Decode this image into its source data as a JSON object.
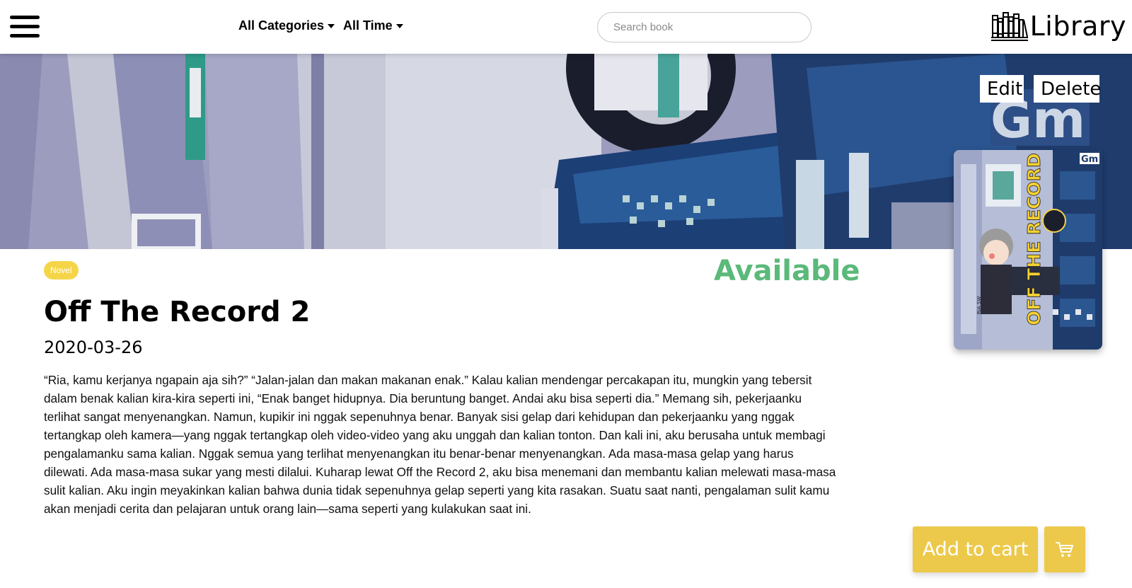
{
  "navbar": {
    "categories_label": "All Categories",
    "time_label": "All Time",
    "search_placeholder": "Search book",
    "brand": "Library"
  },
  "book": {
    "category": "Novel",
    "status": "Available",
    "title": "Off The Record 2",
    "date": "2020-03-26",
    "description": "“Ria, kamu kerjanya ngapain aja sih?” “Jalan-jalan dan makan makanan enak.” Kalau kalian mendengar percakapan itu, mungkin yang tebersit dalam benak kalian kira-kira seperti ini, “Enak banget hidupnya. Dia beruntung banget. Andai aku bisa seperti dia.” Memang sih, pekerjaanku terlihat sangat menyenangkan. Namun, kupikir ini nggak sepenuhnya benar. Banyak sisi gelap dari kehidupan dan pekerjaanku yang nggak tertangkap oleh kamera—yang nggak tertangkap oleh video-video yang aku unggah dan kalian tonton. Dan kali ini, aku berusaha untuk membagi pengalamanku sama kalian. Nggak semua yang terlihat menyenangkan itu benar-benar menyenangkan. Ada masa-masa gelap yang harus dilewati. Ada masa-masa sukar yang mesti dilalui. Kuharap lewat Off the Record 2, aku bisa menemani dan membantu kalian melewati masa-masa sulit kalian. Aku ingin meyakinkan kalian bahwa dunia tidak sepenuhnya gelap seperti yang kita rasakan. Suatu saat nanti, pengalaman sulit kamu akan menjadi cerita dan pelajaran untuk orang lain—sama seperti yang kulakukan saat ini.",
    "cover_title": "OFF THE RECORD 2",
    "cover_author": "RIA SW",
    "cover_logo": "Gm"
  },
  "actions": {
    "edit_label": "Edit",
    "delete_label": "Delete",
    "add_to_cart_label": "Add to cart",
    "cart_icon": "cart-icon"
  },
  "colors": {
    "accent_yellow": "#ecc94b",
    "badge_yellow": "#f5d548",
    "status_green": "#5bb97a"
  }
}
